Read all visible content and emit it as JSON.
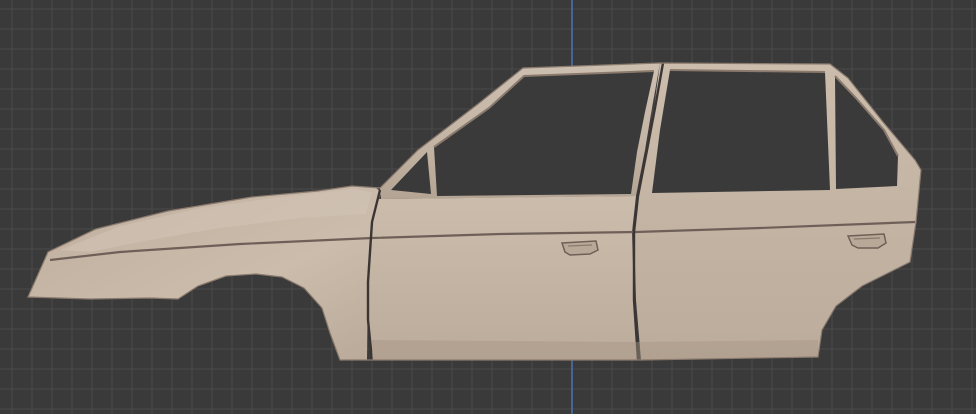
{
  "viewport": {
    "mode": "orthographic-side-view",
    "grid_visible": true,
    "vertical_axis_visible": true
  },
  "colors": {
    "background": "#3a3a3a",
    "grid_line": "#4a4a4a",
    "z_axis": "#4f7bc4",
    "body_paint": "#c7b8a8",
    "body_shadow": "#a69585",
    "seam": "#3b3634",
    "trim_line": "#6e6058"
  },
  "model": {
    "kind": "car-body-shell",
    "view": "left-side",
    "parts": [
      "hood",
      "front-fender",
      "a-pillar",
      "front-door",
      "rear-door",
      "c-pillar",
      "door-handles",
      "body-crease-line"
    ]
  }
}
